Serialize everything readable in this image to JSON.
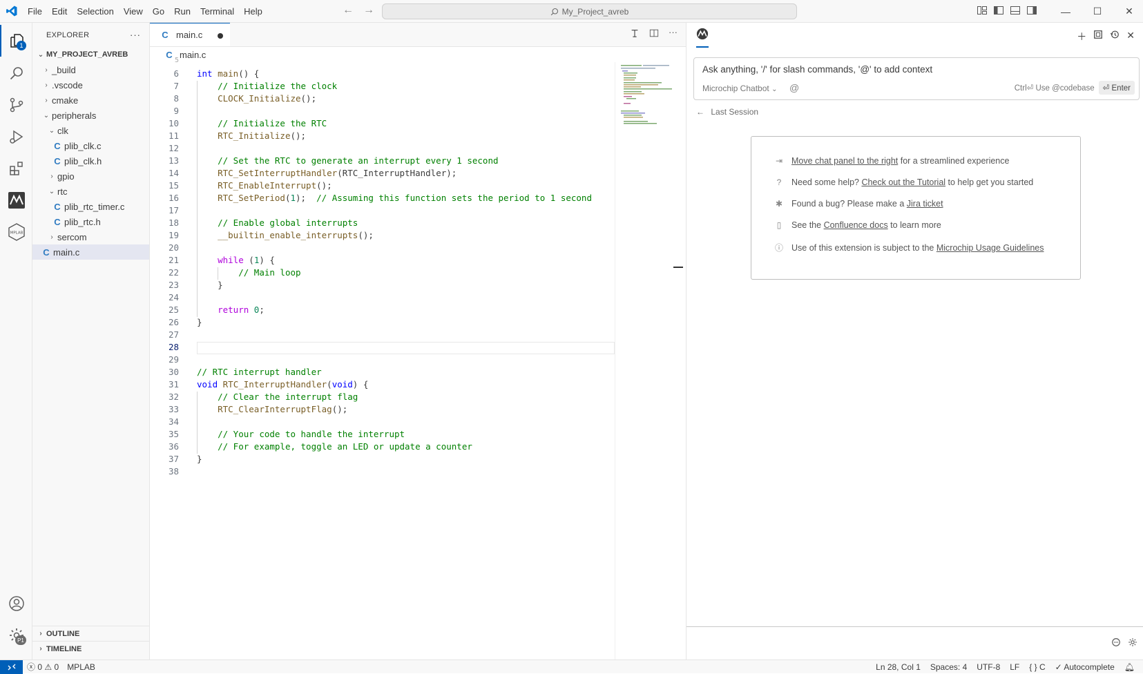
{
  "menu": [
    "File",
    "Edit",
    "Selection",
    "View",
    "Go",
    "Run",
    "Terminal",
    "Help"
  ],
  "search": {
    "text": "My_Project_avreb"
  },
  "activity": {
    "explorer_badge": "1",
    "settings_badge": "P1"
  },
  "explorer": {
    "title": "EXPLORER",
    "more": "···",
    "root": "MY_PROJECT_AVREB",
    "items": [
      {
        "label": "_build",
        "type": "folder",
        "depth": 1,
        "open": false
      },
      {
        "label": ".vscode",
        "type": "folder",
        "depth": 1,
        "open": false
      },
      {
        "label": "cmake",
        "type": "folder",
        "depth": 1,
        "open": false
      },
      {
        "label": "peripherals",
        "type": "folder",
        "depth": 1,
        "open": true
      },
      {
        "label": "clk",
        "type": "folder",
        "depth": 2,
        "open": true
      },
      {
        "label": "plib_clk.c",
        "type": "file",
        "depth": 3
      },
      {
        "label": "plib_clk.h",
        "type": "file",
        "depth": 3
      },
      {
        "label": "gpio",
        "type": "folder",
        "depth": 2,
        "open": false
      },
      {
        "label": "rtc",
        "type": "folder",
        "depth": 2,
        "open": true
      },
      {
        "label": "plib_rtc_timer.c",
        "type": "file",
        "depth": 3
      },
      {
        "label": "plib_rtc.h",
        "type": "file",
        "depth": 3
      },
      {
        "label": "sercom",
        "type": "folder",
        "depth": 2,
        "open": false
      },
      {
        "label": "main.c",
        "type": "file",
        "depth": 1,
        "selected": true
      }
    ],
    "outline": "OUTLINE",
    "timeline": "TIMELINE"
  },
  "editor": {
    "tab_label": "main.c",
    "breadcrumb": "main.c",
    "file_icon": "C",
    "current_line": 28,
    "lines": [
      {
        "n": 6,
        "html": "<span class=\"kw\">int</span> <span class=\"fn\">main</span>() {"
      },
      {
        "n": 7,
        "html": "    <span class=\"cm\">// Initialize the clock</span>"
      },
      {
        "n": 8,
        "html": "    <span class=\"fn\">CLOCK_Initialize</span>();"
      },
      {
        "n": 9,
        "html": ""
      },
      {
        "n": 10,
        "html": "    <span class=\"cm\">// Initialize the RTC</span>"
      },
      {
        "n": 11,
        "html": "    <span class=\"fn\">RTC_Initialize</span>();"
      },
      {
        "n": 12,
        "html": ""
      },
      {
        "n": 13,
        "html": "    <span class=\"cm\">// Set the RTC to generate an interrupt every 1 second</span>"
      },
      {
        "n": 14,
        "html": "    <span class=\"fn\">RTC_SetInterruptHandler</span>(RTC_InterruptHandler);"
      },
      {
        "n": 15,
        "html": "    <span class=\"fn\">RTC_EnableInterrupt</span>();"
      },
      {
        "n": 16,
        "html": "    <span class=\"fn\">RTC_SetPeriod</span>(<span class=\"nm\">1</span>);  <span class=\"cm\">// Assuming this function sets the period to 1 second</span>"
      },
      {
        "n": 17,
        "html": ""
      },
      {
        "n": 18,
        "html": "    <span class=\"cm\">// Enable global interrupts</span>"
      },
      {
        "n": 19,
        "html": "    <span class=\"fn\">__builtin_enable_interrupts</span>();"
      },
      {
        "n": 20,
        "html": ""
      },
      {
        "n": 21,
        "html": "    <span class=\"kw2\">while</span> (<span class=\"nm\">1</span>) {"
      },
      {
        "n": 22,
        "html": "        <span class=\"cm\">// Main loop</span>"
      },
      {
        "n": 23,
        "html": "    }"
      },
      {
        "n": 24,
        "html": ""
      },
      {
        "n": 25,
        "html": "    <span class=\"kw2\">return</span> <span class=\"nm\">0</span>;"
      },
      {
        "n": 26,
        "html": "}"
      },
      {
        "n": 27,
        "html": ""
      },
      {
        "n": 28,
        "html": ""
      },
      {
        "n": 29,
        "html": ""
      },
      {
        "n": 30,
        "html": "<span class=\"cm\">// RTC interrupt handler</span>"
      },
      {
        "n": 31,
        "html": "<span class=\"kw\">void</span> <span class=\"fn\">RTC_InterruptHandler</span>(<span class=\"kw\">void</span>) {"
      },
      {
        "n": 32,
        "html": "    <span class=\"cm\">// Clear the interrupt flag</span>"
      },
      {
        "n": 33,
        "html": "    <span class=\"fn\">RTC_ClearInterruptFlag</span>();"
      },
      {
        "n": 34,
        "html": ""
      },
      {
        "n": 35,
        "html": "    <span class=\"cm\">// Your code to handle the interrupt</span>"
      },
      {
        "n": 36,
        "html": "    <span class=\"cm\">// For example, toggle an LED or update a counter</span>"
      },
      {
        "n": 37,
        "html": "}"
      },
      {
        "n": 38,
        "html": ""
      }
    ]
  },
  "chat": {
    "input_placeholder": "Ask anything, '/' for slash commands, '@' to add context",
    "model": "Microchip Chatbot",
    "at": "@",
    "ctrl_hint": "Ctrl⏎ Use @codebase",
    "enter": "⏎ Enter",
    "last_session": "Last Session",
    "info": [
      {
        "icon": "arrow-right-box-icon",
        "pre": "",
        "link": "Move chat panel to the right",
        "post": " for a streamlined experience"
      },
      {
        "icon": "question-icon",
        "pre": "Need some help? ",
        "link": "Check out the Tutorial",
        "post": " to help get you started"
      },
      {
        "icon": "bug-icon",
        "pre": "Found a bug? Please make a ",
        "link": "Jira ticket",
        "post": ""
      },
      {
        "icon": "book-icon",
        "pre": "See the ",
        "link": "Confluence docs",
        "post": " to learn more"
      },
      {
        "icon": "info-icon",
        "pre": "Use of this extension is subject to the ",
        "link": "Microchip Usage Guidelines",
        "post": ""
      }
    ]
  },
  "status": {
    "errors": "0",
    "warnings": "0",
    "mplab": "MPLAB",
    "position": "Ln 28, Col 1",
    "spaces": "Spaces: 4",
    "encoding": "UTF-8",
    "eol": "LF",
    "language": "C",
    "language_icon": "{ }",
    "autocomplete": "Autocomplete"
  },
  "colors": {
    "accent": "#005fb8",
    "comment": "#008000",
    "keyword": "#0000ff",
    "function": "#795e26"
  }
}
